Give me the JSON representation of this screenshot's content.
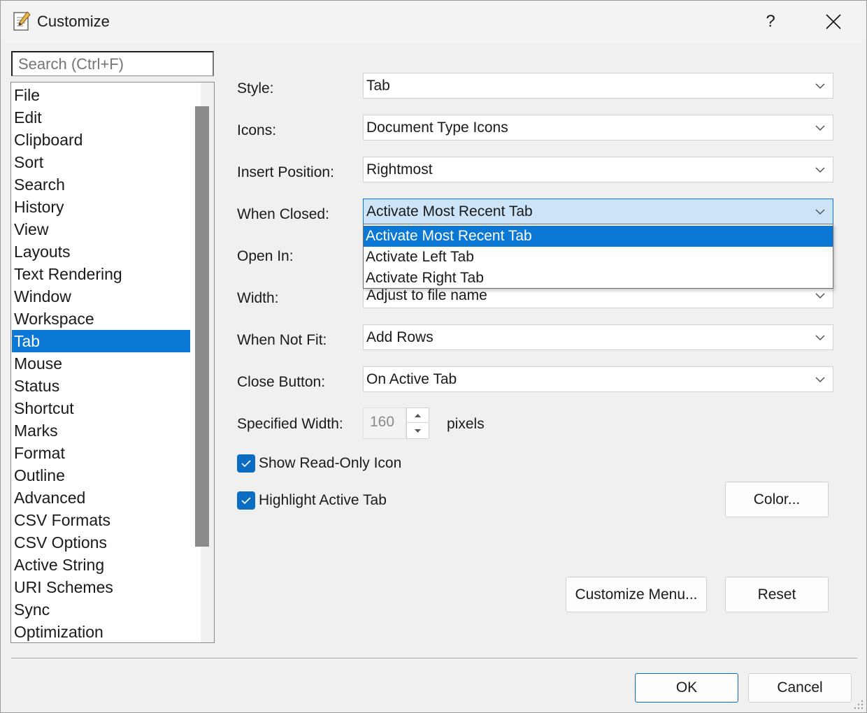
{
  "window": {
    "title": "Customize",
    "help_label": "?"
  },
  "search": {
    "placeholder": "Search (Ctrl+F)"
  },
  "categories": [
    "File",
    "Edit",
    "Clipboard",
    "Sort",
    "Search",
    "History",
    "View",
    "Layouts",
    "Text Rendering",
    "Window",
    "Workspace",
    "Tab",
    "Mouse",
    "Status",
    "Shortcut",
    "Marks",
    "Format",
    "Outline",
    "Advanced",
    "CSV Formats",
    "CSV Options",
    "Active String",
    "URI Schemes",
    "Sync",
    "Optimization"
  ],
  "selected_category": "Tab",
  "fields": {
    "style": {
      "label": "Style:",
      "value": "Tab"
    },
    "icons": {
      "label": "Icons:",
      "value": "Document Type Icons"
    },
    "insert_position": {
      "label": "Insert Position:",
      "value": "Rightmost"
    },
    "when_closed": {
      "label": "When Closed:",
      "value": "Activate Most Recent Tab"
    },
    "open_in": {
      "label": "Open In:"
    },
    "width": {
      "label": "Width:",
      "value": "Adjust to file name"
    },
    "when_not_fit": {
      "label": "When Not Fit:",
      "value": "Add Rows"
    },
    "close_button": {
      "label": "Close Button:",
      "value": "On Active Tab"
    },
    "specified_width": {
      "label": "Specified Width:",
      "value": "160",
      "unit": "pixels"
    }
  },
  "dropdown_options": [
    "Activate Most Recent Tab",
    "Activate Left Tab",
    "Activate Right Tab"
  ],
  "dropdown_selected": "Activate Most Recent Tab",
  "checkboxes": {
    "show_read_only_icon": {
      "label": "Show Read-Only Icon",
      "checked": true
    },
    "highlight_active_tab": {
      "label": "Highlight Active Tab",
      "checked": true
    }
  },
  "buttons": {
    "color": "Color...",
    "customize_menu": "Customize Menu...",
    "reset": "Reset",
    "ok": "OK",
    "cancel": "Cancel"
  },
  "colors": {
    "accent": "#0a78d4",
    "checkbox": "#0a6dc2",
    "focus_bg": "#cce4f7"
  }
}
